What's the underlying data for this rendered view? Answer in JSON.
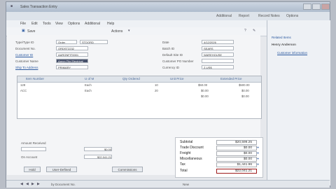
{
  "window": {
    "title": "Sales Transaction Entry"
  },
  "ribbon": {
    "tabs": [
      "Additional",
      "Report",
      "Record Notes",
      "Options"
    ]
  },
  "menu": {
    "items": [
      "File",
      "Edit",
      "Tools",
      "View",
      "Options",
      "Additional",
      "Help"
    ]
  },
  "toolbar": {
    "save": "Save",
    "actions": "Actions"
  },
  "header": {
    "type_id_label": "Type/Type ID",
    "type_id": "Order",
    "type_id_num": "STDORD",
    "doc_no_label": "Document No.",
    "doc_no": "ORDST2232",
    "customer_id_label": "Customer ID",
    "customer_id": "AARONFIT0001",
    "customer_name_label": "Customer Name",
    "customer_name": "Aaron Fitz Electrical",
    "ship_to_label": "Ship To Address",
    "ship_to": "PRIMARY",
    "date_label": "Date",
    "date": "4/12/2026",
    "batch_label": "Batch ID",
    "batch": "SEARS",
    "default_site_label": "Default Site ID",
    "default_site": "WAREHOUSE",
    "customer_po_label": "Customer PO Number",
    "currency_label": "Currency ID",
    "currency": "Z-US$"
  },
  "grid": {
    "columns": [
      "Item Number",
      "U of M",
      "Qty Ordered",
      "Unit Price",
      "Extended Price"
    ],
    "rows": [
      {
        "item": "128",
        "uom": "Each",
        "qty": "10",
        "unit": "$50.00",
        "ext": "$500.00"
      },
      {
        "item": "ACC",
        "uom": "Each",
        "qty": "20",
        "unit": "$0.00",
        "ext": "$0.00"
      },
      {
        "item": "",
        "uom": "",
        "qty": "",
        "unit": "$0.00",
        "ext": "$0.00"
      }
    ]
  },
  "totals": {
    "subtotal_label": "Subtotal",
    "subtotal": "$20,599.25",
    "trade_discount_label": "Trade Discount",
    "trade_discount": "$0.00",
    "freight_label": "Freight",
    "freight": "$0.00",
    "misc_label": "Miscellaneous",
    "misc": "$0.00",
    "tax_label": "Tax",
    "tax": "$1,441.96",
    "total_label": "Total",
    "total": "$22,041.21"
  },
  "footer": {
    "amount_received_label": "Amount Received",
    "amount_received": "$0.00",
    "on_account_label": "On Account",
    "on_account": "$22,041.21",
    "buttons": [
      "Hold",
      "User-Defined",
      "Commissions"
    ],
    "sort_label": "by Document No.",
    "status": "New"
  },
  "side": {
    "title": "Related Items",
    "name": "Henry Anderson",
    "link": "Customer information"
  }
}
